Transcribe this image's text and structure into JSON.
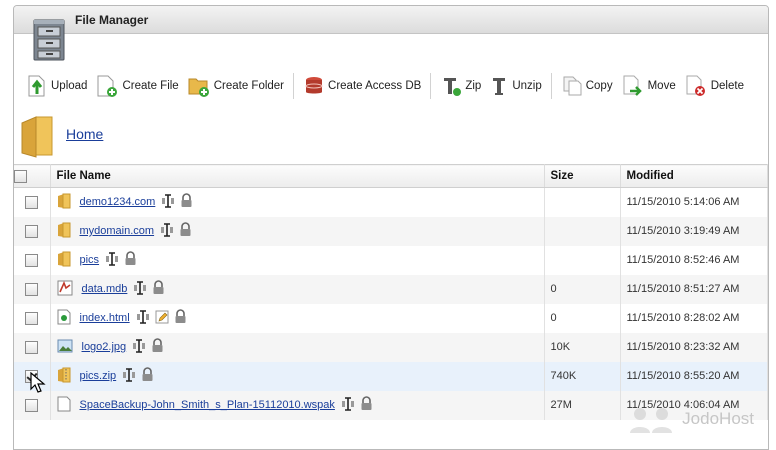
{
  "window": {
    "title": "File Manager"
  },
  "toolbar": {
    "upload": "Upload",
    "create_file": "Create File",
    "create_folder": "Create Folder",
    "create_access_db": "Create Access DB",
    "zip": "Zip",
    "unzip": "Unzip",
    "copy": "Copy",
    "move": "Move",
    "delete": "Delete"
  },
  "breadcrumb": {
    "home": "Home"
  },
  "table": {
    "headers": {
      "name": "File Name",
      "size": "Size",
      "modified": "Modified"
    },
    "rows": [
      {
        "name": "demo1234.com",
        "type": "folder",
        "size": "",
        "modified": "11/15/2010 5:14:06 AM",
        "checked": false,
        "edit": false
      },
      {
        "name": "mydomain.com",
        "type": "folder",
        "size": "",
        "modified": "11/15/2010 3:19:49 AM",
        "checked": false,
        "edit": false
      },
      {
        "name": "pics",
        "type": "folder",
        "size": "",
        "modified": "11/15/2010 8:52:46 AM",
        "checked": false,
        "edit": false
      },
      {
        "name": "data.mdb",
        "type": "mdb",
        "size": "0",
        "modified": "11/15/2010 8:51:27 AM",
        "checked": false,
        "edit": false
      },
      {
        "name": "index.html",
        "type": "html",
        "size": "0",
        "modified": "11/15/2010 8:28:02 AM",
        "checked": false,
        "edit": true
      },
      {
        "name": "logo2.jpg",
        "type": "image",
        "size": "10K",
        "modified": "11/15/2010 8:23:32 AM",
        "checked": false,
        "edit": false
      },
      {
        "name": "pics.zip",
        "type": "zip",
        "size": "740K",
        "modified": "11/15/2010 8:55:20 AM",
        "checked": true,
        "edit": false
      },
      {
        "name": "SpaceBackup-John_Smith_s_Plan-15112010.wspak",
        "type": "file",
        "size": "27M",
        "modified": "11/15/2010 4:06:04 AM",
        "checked": false,
        "edit": false
      }
    ]
  },
  "watermark": {
    "text": "JodoHost"
  },
  "colors": {
    "link": "#1a3e9a",
    "selected_row": "#e8f1fb",
    "folder": "#e8b84a"
  }
}
